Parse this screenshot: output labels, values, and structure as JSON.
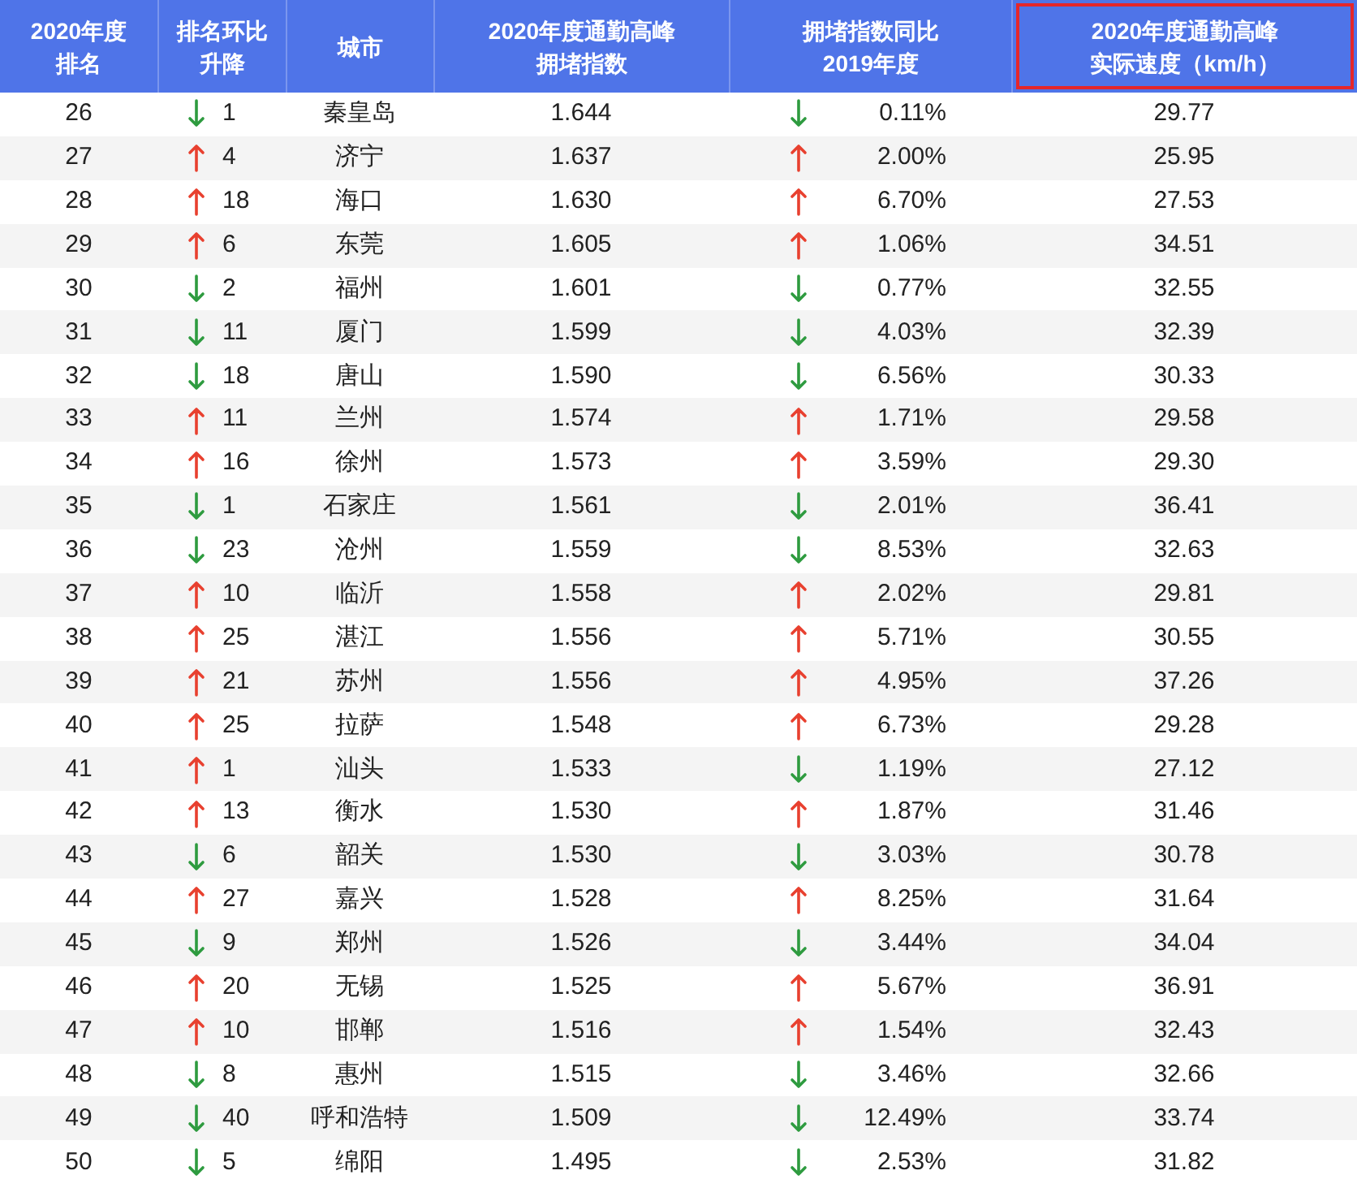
{
  "columns": [
    {
      "lines": [
        "2020年度",
        "排名"
      ],
      "highlighted": false
    },
    {
      "lines": [
        "排名环比",
        "升降"
      ],
      "highlighted": false
    },
    {
      "lines": [
        "城市"
      ],
      "highlighted": false
    },
    {
      "lines": [
        "2020年度通勤高峰",
        "拥堵指数"
      ],
      "highlighted": false
    },
    {
      "lines": [
        "拥堵指数同比",
        "2019年度"
      ],
      "highlighted": false
    },
    {
      "lines": [
        "2020年度通勤高峰",
        "实际速度（km/h）"
      ],
      "highlighted": true
    }
  ],
  "rows": [
    {
      "rank": "26",
      "rank_rising": false,
      "rank_change": "1",
      "city": "秦皇岛",
      "index": "1.644",
      "yoy_rising": false,
      "yoy": "0.11%",
      "speed": "29.77"
    },
    {
      "rank": "27",
      "rank_rising": true,
      "rank_change": "4",
      "city": "济宁",
      "index": "1.637",
      "yoy_rising": true,
      "yoy": "2.00%",
      "speed": "25.95"
    },
    {
      "rank": "28",
      "rank_rising": true,
      "rank_change": "18",
      "city": "海口",
      "index": "1.630",
      "yoy_rising": true,
      "yoy": "6.70%",
      "speed": "27.53"
    },
    {
      "rank": "29",
      "rank_rising": true,
      "rank_change": "6",
      "city": "东莞",
      "index": "1.605",
      "yoy_rising": true,
      "yoy": "1.06%",
      "speed": "34.51"
    },
    {
      "rank": "30",
      "rank_rising": false,
      "rank_change": "2",
      "city": "福州",
      "index": "1.601",
      "yoy_rising": false,
      "yoy": "0.77%",
      "speed": "32.55"
    },
    {
      "rank": "31",
      "rank_rising": false,
      "rank_change": "11",
      "city": "厦门",
      "index": "1.599",
      "yoy_rising": false,
      "yoy": "4.03%",
      "speed": "32.39"
    },
    {
      "rank": "32",
      "rank_rising": false,
      "rank_change": "18",
      "city": "唐山",
      "index": "1.590",
      "yoy_rising": false,
      "yoy": "6.56%",
      "speed": "30.33"
    },
    {
      "rank": "33",
      "rank_rising": true,
      "rank_change": "11",
      "city": "兰州",
      "index": "1.574",
      "yoy_rising": true,
      "yoy": "1.71%",
      "speed": "29.58"
    },
    {
      "rank": "34",
      "rank_rising": true,
      "rank_change": "16",
      "city": "徐州",
      "index": "1.573",
      "yoy_rising": true,
      "yoy": "3.59%",
      "speed": "29.30"
    },
    {
      "rank": "35",
      "rank_rising": false,
      "rank_change": "1",
      "city": "石家庄",
      "index": "1.561",
      "yoy_rising": false,
      "yoy": "2.01%",
      "speed": "36.41"
    },
    {
      "rank": "36",
      "rank_rising": false,
      "rank_change": "23",
      "city": "沧州",
      "index": "1.559",
      "yoy_rising": false,
      "yoy": "8.53%",
      "speed": "32.63"
    },
    {
      "rank": "37",
      "rank_rising": true,
      "rank_change": "10",
      "city": "临沂",
      "index": "1.558",
      "yoy_rising": true,
      "yoy": "2.02%",
      "speed": "29.81"
    },
    {
      "rank": "38",
      "rank_rising": true,
      "rank_change": "25",
      "city": "湛江",
      "index": "1.556",
      "yoy_rising": true,
      "yoy": "5.71%",
      "speed": "30.55"
    },
    {
      "rank": "39",
      "rank_rising": true,
      "rank_change": "21",
      "city": "苏州",
      "index": "1.556",
      "yoy_rising": true,
      "yoy": "4.95%",
      "speed": "37.26"
    },
    {
      "rank": "40",
      "rank_rising": true,
      "rank_change": "25",
      "city": "拉萨",
      "index": "1.548",
      "yoy_rising": true,
      "yoy": "6.73%",
      "speed": "29.28"
    },
    {
      "rank": "41",
      "rank_rising": true,
      "rank_change": "1",
      "city": "汕头",
      "index": "1.533",
      "yoy_rising": false,
      "yoy": "1.19%",
      "speed": "27.12"
    },
    {
      "rank": "42",
      "rank_rising": true,
      "rank_change": "13",
      "city": "衡水",
      "index": "1.530",
      "yoy_rising": true,
      "yoy": "1.87%",
      "speed": "31.46"
    },
    {
      "rank": "43",
      "rank_rising": false,
      "rank_change": "6",
      "city": "韶关",
      "index": "1.530",
      "yoy_rising": false,
      "yoy": "3.03%",
      "speed": "30.78"
    },
    {
      "rank": "44",
      "rank_rising": true,
      "rank_change": "27",
      "city": "嘉兴",
      "index": "1.528",
      "yoy_rising": true,
      "yoy": "8.25%",
      "speed": "31.64"
    },
    {
      "rank": "45",
      "rank_rising": false,
      "rank_change": "9",
      "city": "郑州",
      "index": "1.526",
      "yoy_rising": false,
      "yoy": "3.44%",
      "speed": "34.04"
    },
    {
      "rank": "46",
      "rank_rising": true,
      "rank_change": "20",
      "city": "无锡",
      "index": "1.525",
      "yoy_rising": true,
      "yoy": "5.67%",
      "speed": "36.91"
    },
    {
      "rank": "47",
      "rank_rising": true,
      "rank_change": "10",
      "city": "邯郸",
      "index": "1.516",
      "yoy_rising": true,
      "yoy": "1.54%",
      "speed": "32.43"
    },
    {
      "rank": "48",
      "rank_rising": false,
      "rank_change": "8",
      "city": "惠州",
      "index": "1.515",
      "yoy_rising": false,
      "yoy": "3.46%",
      "speed": "32.66"
    },
    {
      "rank": "49",
      "rank_rising": false,
      "rank_change": "40",
      "city": "呼和浩特",
      "index": "1.509",
      "yoy_rising": false,
      "yoy": "12.49%",
      "speed": "33.74"
    },
    {
      "rank": "50",
      "rank_rising": false,
      "rank_change": "5",
      "city": "绵阳",
      "index": "1.495",
      "yoy_rising": false,
      "yoy": "2.53%",
      "speed": "31.82"
    }
  ]
}
